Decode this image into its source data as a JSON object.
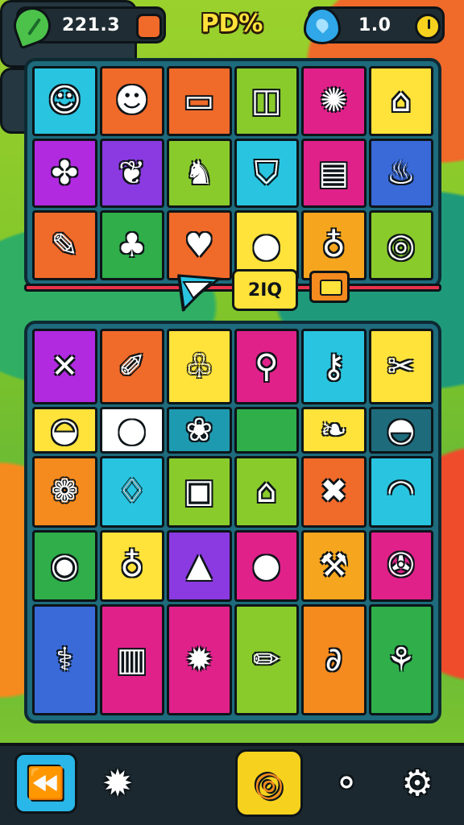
{
  "hud": {
    "left_value": "221.3",
    "center_title": "PD%",
    "right_value": "1.0",
    "left_icon": "leaf-icon",
    "left_secondary_icon": "gem-icon",
    "right_icon": "heart-icon",
    "right_secondary_icon": "clock-icon"
  },
  "top_board": {
    "tiles": [
      {
        "color": "#29c4e0",
        "icon": "face-icon",
        "glyph": "☺"
      },
      {
        "color": "#f06a2a",
        "icon": "smiley-icon",
        "glyph": "☻"
      },
      {
        "color": "#f06a2a",
        "icon": "gift-box-icon",
        "glyph": "▭"
      },
      {
        "color": "#8acb2c",
        "icon": "cube-icon",
        "glyph": "◫"
      },
      {
        "color": "#e0218a",
        "icon": "fire-bush-icon",
        "glyph": "✺"
      },
      {
        "color": "#ffe23a",
        "icon": "house-box-icon",
        "glyph": "⌂"
      },
      {
        "color": "#b12ae0",
        "icon": "bug-icon",
        "glyph": "✤"
      },
      {
        "color": "#8a3ae0",
        "icon": "leaves-icon",
        "glyph": "❦"
      },
      {
        "color": "#8acb2c",
        "icon": "cat-icon",
        "glyph": "♞"
      },
      {
        "color": "#29c4e0",
        "icon": "shield-icon",
        "glyph": "⛉"
      },
      {
        "color": "#e0218a",
        "icon": "book-icon",
        "glyph": "▤"
      },
      {
        "color": "#3a6ad8",
        "icon": "flame-icon",
        "glyph": "♨"
      },
      {
        "color": "#f06a2a",
        "icon": "pen-icon",
        "glyph": "✎"
      },
      {
        "color": "#2fae4a",
        "icon": "palm-tree-icon",
        "glyph": "♣"
      },
      {
        "color": "#f06a2a",
        "icon": "apple-icon",
        "glyph": "♥"
      },
      {
        "color": "#ffe23a",
        "icon": "balloon-icon",
        "glyph": "●"
      },
      {
        "color": "#f6a51e",
        "icon": "lightbulb-icon",
        "glyph": "♁"
      },
      {
        "color": "#8acb2c",
        "icon": "compass-icon",
        "glyph": "◎"
      }
    ]
  },
  "middle": {
    "label": "2IQ",
    "flag_icon": "flag-icon",
    "chest_icon": "chest-icon"
  },
  "bottom_board": {
    "tiles": [
      {
        "color": "#b12ae0",
        "icon": "crossed-pencils-icon",
        "glyph": "✕"
      },
      {
        "color": "#f06a2a",
        "icon": "pencil-icon",
        "glyph": "✐"
      },
      {
        "color": "#ffe23a",
        "icon": "cherries-icon",
        "glyph": "♧"
      },
      {
        "color": "#e0218a",
        "icon": "joystick-icon",
        "glyph": "⚲"
      },
      {
        "color": "#29c4e0",
        "icon": "key-icon",
        "glyph": "⚷"
      },
      {
        "color": "#ffe23a",
        "icon": "tools-icon",
        "glyph": "✂"
      },
      {
        "color": "#ffe23a",
        "icon": "pot-icon",
        "glyph": "◒"
      },
      {
        "color": "#ffffff",
        "icon": "ball-icon",
        "glyph": "●"
      },
      {
        "color": "#1e9ab0",
        "icon": "caterpillar-icon",
        "glyph": "❀"
      },
      {
        "color": "#2fae4a",
        "icon": "blank-tile-icon",
        "glyph": ""
      },
      {
        "color": "#ffe23a",
        "icon": "fish-leaf-icon",
        "glyph": "❧"
      },
      {
        "color": "#1e6b7c",
        "icon": "dish-icon",
        "glyph": "◓"
      },
      {
        "color": "#f58a1e",
        "icon": "leaf-icon",
        "glyph": "❁"
      },
      {
        "color": "#29c4e0",
        "icon": "balloon-face-icon",
        "glyph": "♢"
      },
      {
        "color": "#8acb2c",
        "icon": "frame-icon",
        "glyph": "▣"
      },
      {
        "color": "#8acb2c",
        "icon": "gift-box-icon",
        "glyph": "⌂"
      },
      {
        "color": "#f06a2a",
        "icon": "crossed-tools-icon",
        "glyph": "✖"
      },
      {
        "color": "#29c4e0",
        "icon": "hat-icon",
        "glyph": "◠"
      },
      {
        "color": "#2fae4a",
        "icon": "dial-icon",
        "glyph": "◉"
      },
      {
        "color": "#ffe23a",
        "icon": "lightbulb-icon",
        "glyph": "♁"
      },
      {
        "color": "#8a3ae0",
        "icon": "cone-icon",
        "glyph": "▲"
      },
      {
        "color": "#e0218a",
        "icon": "ball-icon",
        "glyph": "●"
      },
      {
        "color": "#f6a51e",
        "icon": "wrench-icon",
        "glyph": "⚒"
      },
      {
        "color": "#e0218a",
        "icon": "wheel-icon",
        "glyph": "✇"
      },
      {
        "color": "#3a6ad8",
        "icon": "scepter-icon",
        "glyph": "⚕"
      },
      {
        "color": "#e0218a",
        "icon": "luggage-icon",
        "glyph": "▥"
      },
      {
        "color": "#e0218a",
        "icon": "lemon-icon",
        "glyph": "✹"
      },
      {
        "color": "#8acb2c",
        "icon": "marker-icon",
        "glyph": "✏"
      },
      {
        "color": "#f58a1e",
        "icon": "swan-icon",
        "glyph": "∂"
      },
      {
        "color": "#2fae4a",
        "icon": "cane-icon",
        "glyph": "⚘"
      }
    ]
  },
  "bottom_bar": {
    "back_icon": "rewind-icon",
    "back_glyph": "⏪",
    "gear_glyph": "✹",
    "center_glyph": "◎",
    "search_glyph": "⚬",
    "settings_glyph": "⚙"
  }
}
